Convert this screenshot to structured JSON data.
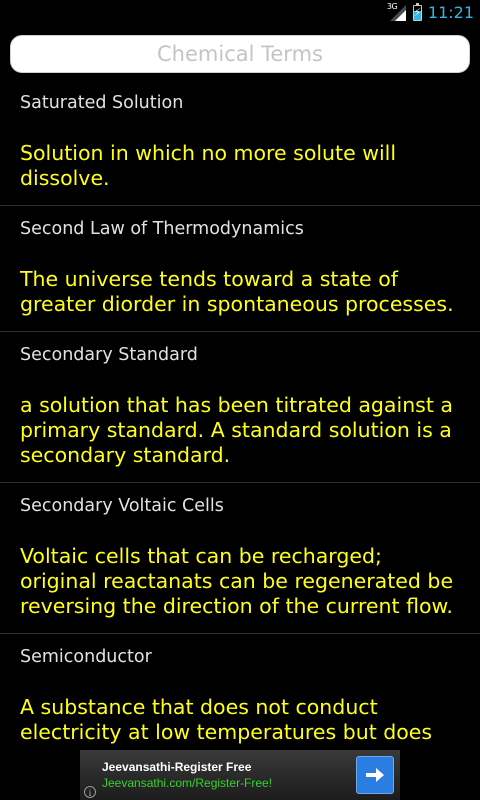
{
  "status_bar": {
    "network": "3G",
    "time": "11:21"
  },
  "search": {
    "placeholder": "Chemical Terms"
  },
  "entries": [
    {
      "term": "Saturated Solution",
      "definition": "Solution in which no more solute will dissolve."
    },
    {
      "term": "Second Law of Thermodynamics",
      "definition": "The universe tends toward a state of greater diorder in spontaneous processes."
    },
    {
      "term": "Secondary Standard",
      "definition": "a solution that has been titrated against a primary standard. A standard solution is a secondary standard."
    },
    {
      "term": "Secondary Voltaic Cells",
      "definition": "Voltaic cells that can be recharged; original reactanats can be regenerated be reversing the direction of the current flow."
    },
    {
      "term": "Semiconductor",
      "definition": "A substance that does not conduct electricity at low temperatures but does so"
    }
  ],
  "ad": {
    "title": "Jeevansathi-Register Free",
    "url": "Jeevansathi.com/Register-Free!",
    "info_glyph": "i"
  },
  "colors": {
    "term": "#e2e2e2",
    "definition": "#ffff1a",
    "clock": "#33b5e5",
    "ad_url": "#36d32a",
    "ad_button": "#2a7de1"
  },
  "icons": {
    "signal": "signal-strength-icon",
    "battery": "battery-charging-icon",
    "ad_action": "arrow-right-icon",
    "ad_info": "info-icon"
  }
}
